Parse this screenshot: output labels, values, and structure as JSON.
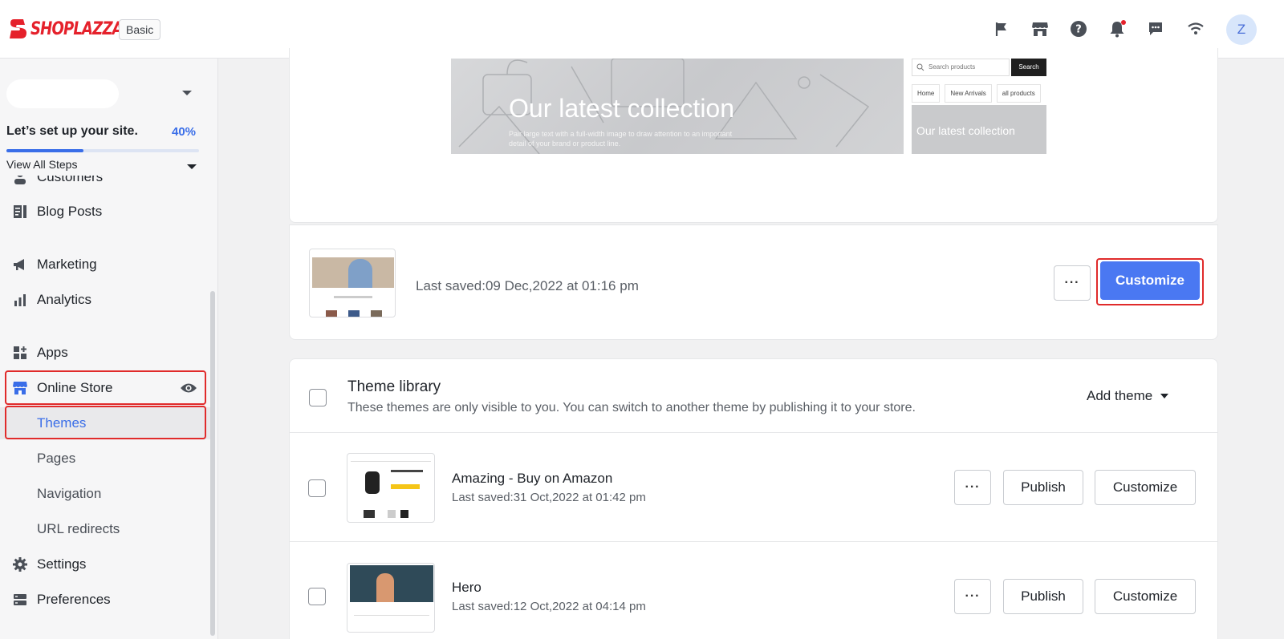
{
  "header": {
    "logo_text": "SHOPLAZZA",
    "plan_badge": "Basic",
    "avatar_initial": "Z",
    "icons": [
      "flag-icon",
      "store-icon",
      "help-icon",
      "bell-icon",
      "message-icon",
      "wifi-icon"
    ]
  },
  "sidebar": {
    "setup_title": "Let’s set up your site.",
    "setup_percent": "40%",
    "setup_progress": 0.4,
    "view_all_steps": "View All Steps",
    "partial_item": "Customers",
    "items": [
      {
        "label": "Blog Posts",
        "icon": "blog-posts-icon"
      },
      {
        "label": "Marketing",
        "icon": "megaphone-icon"
      },
      {
        "label": "Analytics",
        "icon": "bar-chart-icon"
      },
      {
        "label": "Apps",
        "icon": "apps-icon"
      },
      {
        "label": "Online Store",
        "icon": "online-store-icon"
      },
      {
        "label": "Settings",
        "icon": "gear-icon"
      },
      {
        "label": "Preferences",
        "icon": "preferences-icon"
      }
    ],
    "sub_items": [
      "Themes",
      "Pages",
      "Navigation",
      "URL redirects"
    ]
  },
  "preview": {
    "hero_title": "Our latest collection",
    "hero_sub": "Pair large text with a full-width image to draw attention to an important detail of your brand or product line.",
    "search_placeholder": "Search products",
    "search_button": "Search",
    "tabs": [
      "Home",
      "New Arrivals",
      "all products"
    ],
    "mini_hero_title": "Our latest collection"
  },
  "current_theme": {
    "last_saved": "Last saved:09 Dec,2022 at 01:16 pm",
    "more_label": "···",
    "customize_label": "Customize"
  },
  "library": {
    "title": "Theme library",
    "description": "These themes are only visible to you. You can switch to another theme by publishing it to your store.",
    "add_theme_label": "Add theme",
    "themes": [
      {
        "name": "Amazing - Buy on Amazon",
        "last_saved": "Last saved:31 Oct,2022 at 01:42 pm",
        "more": "···",
        "publish": "Publish",
        "customize": "Customize"
      },
      {
        "name": "Hero",
        "last_saved": "Last saved:12 Oct,2022 at 04:14 pm",
        "more": "···",
        "publish": "Publish",
        "customize": "Customize"
      }
    ]
  },
  "colors": {
    "accent": "#4a78f2",
    "brand_red": "#e5212b",
    "highlight": "#e02b2b"
  }
}
